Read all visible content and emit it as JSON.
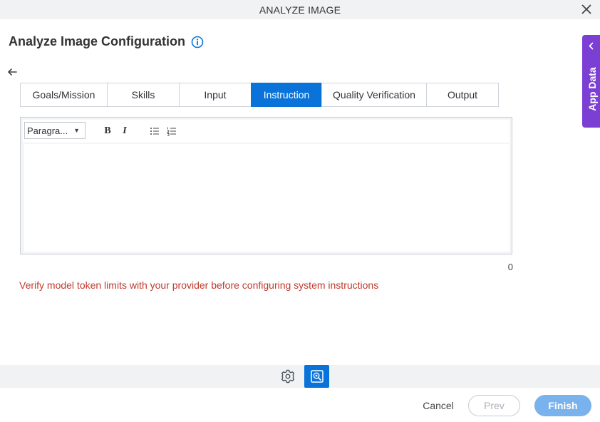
{
  "window": {
    "title": "ANALYZE IMAGE"
  },
  "header": {
    "title": "Analyze Image Configuration"
  },
  "tabs": [
    {
      "label": "Goals/Mission",
      "active": false
    },
    {
      "label": "Skills",
      "active": false
    },
    {
      "label": "Input",
      "active": false
    },
    {
      "label": "Instruction",
      "active": true
    },
    {
      "label": "Quality Verification",
      "active": false
    },
    {
      "label": "Output",
      "active": false
    }
  ],
  "editor": {
    "paragraph_select": "Paragra...",
    "bold_label": "B",
    "italic_label": "I",
    "content": "",
    "char_count": "0"
  },
  "warning_text": "Verify model token limits with your provider before configuring system instructions",
  "footer": {
    "cancel_label": "Cancel",
    "prev_label": "Prev",
    "finish_label": "Finish"
  },
  "side_panel": {
    "label": "App Data"
  },
  "colors": {
    "accent": "#0a73d9",
    "warning": "#c0392b",
    "side_panel": "#7c3fd4",
    "finish_disabled": "#79b2ec"
  }
}
